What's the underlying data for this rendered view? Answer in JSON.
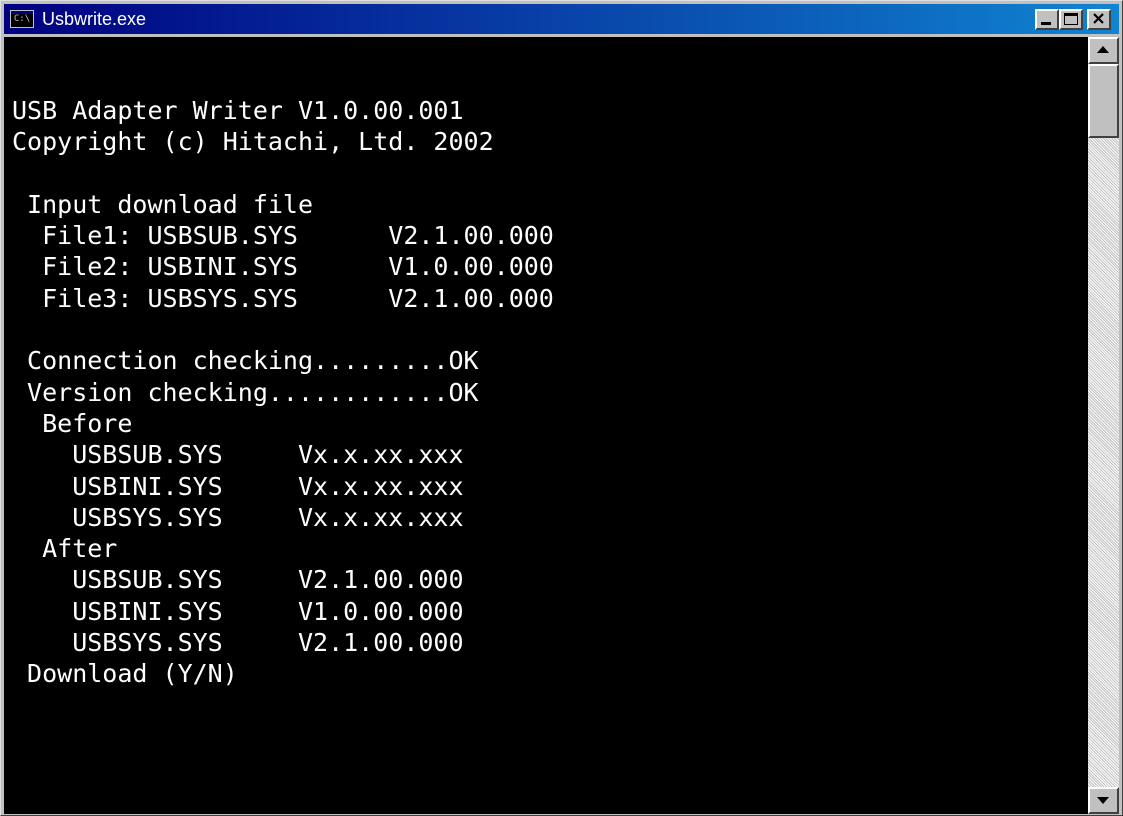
{
  "window": {
    "title": "Usbwrite.exe",
    "icon_text": "C:\\"
  },
  "console": {
    "lines": [
      "USB Adapter Writer V1.0.00.001",
      "Copyright (c) Hitachi, Ltd. 2002",
      "",
      " Input download file",
      "  File1: USBSUB.SYS      V2.1.00.000",
      "  File2: USBINI.SYS      V1.0.00.000",
      "  File3: USBSYS.SYS      V2.1.00.000",
      "",
      " Connection checking.........OK",
      " Version checking............OK",
      "  Before",
      "    USBSUB.SYS     Vx.x.xx.xxx",
      "    USBINI.SYS     Vx.x.xx.xxx",
      "    USBSYS.SYS     Vx.x.xx.xxx",
      "  After",
      "    USBSUB.SYS     V2.1.00.000",
      "    USBINI.SYS     V1.0.00.000",
      "    USBSYS.SYS     V2.1.00.000",
      " Download (Y/N)"
    ]
  },
  "icons": {
    "app": "console-app-icon",
    "minimize": "minimize-icon",
    "maximize": "maximize-icon",
    "close": "close-icon",
    "scroll_up": "scroll-up-icon",
    "scroll_down": "scroll-down-icon"
  },
  "colors": {
    "titlebar_start": "#000080",
    "titlebar_end": "#1084d0",
    "console_bg": "#000000",
    "console_fg": "#ffffff",
    "chrome": "#c0c0c0"
  }
}
